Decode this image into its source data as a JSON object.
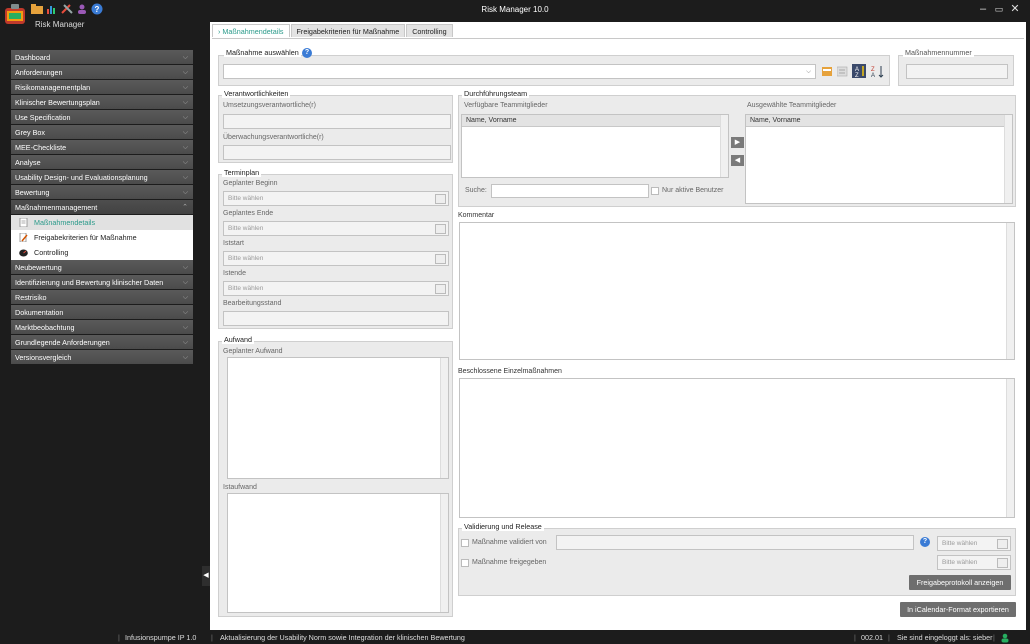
{
  "window": {
    "title": "Risk Manager  10.0",
    "app_name": "Risk Manager",
    "minimize": "–",
    "maximize": "▭",
    "close": "✕"
  },
  "sidebar": {
    "items": [
      {
        "label": "Dashboard"
      },
      {
        "label": "Anforderungen"
      },
      {
        "label": "Risikomanagementplan"
      },
      {
        "label": "Klinischer Bewertungsplan"
      },
      {
        "label": "Use Specification"
      },
      {
        "label": "Grey Box"
      },
      {
        "label": "MEE-Checkliste"
      },
      {
        "label": "Analyse"
      },
      {
        "label": "Usability Design- und Evaluationsplanung"
      },
      {
        "label": "Bewertung"
      },
      {
        "label": "Maßnahmenmanagement"
      },
      {
        "label": "Neubewertung"
      },
      {
        "label": "Identifizierung und Bewertung klinischer Daten"
      },
      {
        "label": "Restrisiko"
      },
      {
        "label": "Dokumentation"
      },
      {
        "label": "Marktbeobachtung"
      },
      {
        "label": "Grundlegende Anforderungen"
      },
      {
        "label": "Versionsvergleich"
      }
    ],
    "subitems": [
      {
        "label": "Maßnahmendetails"
      },
      {
        "label": "Freigabekriterien für Maßnahme"
      },
      {
        "label": "Controlling"
      }
    ]
  },
  "tabs": [
    {
      "label": "› Maßnahmendetails"
    },
    {
      "label": "Freigabekriterien für Maßnahme"
    },
    {
      "label": "Controlling"
    }
  ],
  "massnahme": {
    "select_label": "Maßnahme auswählen",
    "number_label": "Maßnahmennummer",
    "dropdown_arrow": "⌵"
  },
  "verantwortlichkeiten": {
    "title": "Verantwortlichkeiten",
    "umsetzung": "Umsetzungsverantwortliche(r)",
    "ueberwachung": "Überwachungsverantwortliche(r)"
  },
  "terminplan": {
    "title": "Terminplan",
    "geplanter_beginn": "Geplanter Beginn",
    "geplantes_ende": "Geplantes Ende",
    "iststart": "Iststart",
    "istende": "Istende",
    "bearbeitungsstand": "Bearbeitungsstand",
    "placeholder": "Bitte wählen"
  },
  "aufwand": {
    "title": "Aufwand",
    "geplant": "Geplanter Aufwand",
    "ist": "Istaufwand"
  },
  "team": {
    "title": "Durchführungsteam",
    "available": "Verfügbare Teammitglieder",
    "selected": "Ausgewählte Teammitglieder",
    "column": "Name, Vorname",
    "search_label": "Suche:",
    "only_active": "Nur aktive Benutzer",
    "add_arrow": "▶",
    "remove_arrow": "◀"
  },
  "kommentar": {
    "label": "Kommentar"
  },
  "einzelmassnahmen": {
    "label": "Beschlossene Einzelmaßnahmen"
  },
  "validierung": {
    "title": "Validierung und Release",
    "validiert": "Maßnahme validiert von",
    "freigegeben": "Maßnahme freigegeben",
    "placeholder": "Bitte wählen",
    "protocol_button": "Freigabeprotokoll anzeigen"
  },
  "export_button": "In iCalendar-Format exportieren",
  "status": {
    "project": "Infusionspumpe IP 1.0",
    "description": "Aktualisierung der Usability Norm sowie Integration der klinischen Bewertung",
    "version": "002.01",
    "login": "Sie sind eingeloggt als: sieber"
  },
  "help_glyph": "?",
  "colors": {
    "accent": "#2a9a8a",
    "help": "#3a7bd5"
  }
}
